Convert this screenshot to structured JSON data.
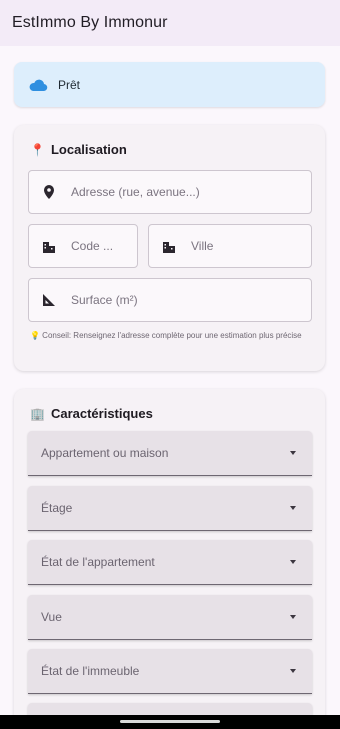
{
  "app_bar": {
    "title": "EstImmo By Immonur"
  },
  "status": {
    "icon": "cloud-icon",
    "text": "Prêt",
    "color": "#2f8fe0"
  },
  "localisation": {
    "emoji": "📍",
    "title": "Localisation",
    "address_placeholder": "Adresse (rue, avenue...)",
    "code_placeholder": "Code ...",
    "ville_placeholder": "Ville",
    "surface_placeholder": "Surface (m²)",
    "tip": "💡 Conseil: Renseignez l'adresse complète pour une estimation plus précise"
  },
  "caracteristiques": {
    "emoji": "🏢",
    "title": "Caractéristiques",
    "selects": [
      "Appartement ou maison",
      "Étage",
      "État de l'appartement",
      "Vue",
      "État de l'immeuble",
      ""
    ]
  }
}
